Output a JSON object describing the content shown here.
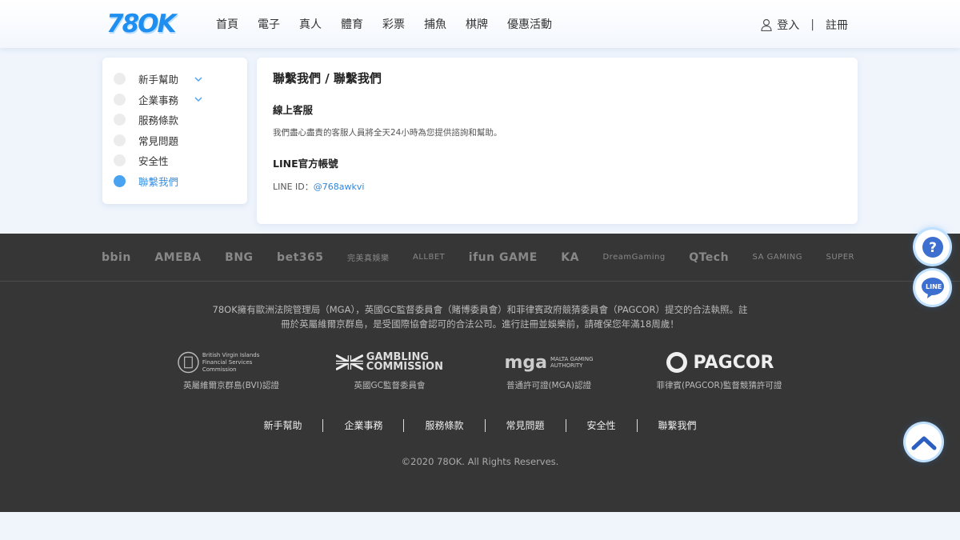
{
  "header": {
    "logo_text": "78OK",
    "nav": [
      "首頁",
      "電子",
      "真人",
      "體育",
      "彩票",
      "捕魚",
      "棋牌",
      "優惠活動"
    ],
    "login": "登入",
    "separator": "|",
    "register": "註冊"
  },
  "sidebar": {
    "items": [
      {
        "label": "新手幫助",
        "expandable": true,
        "active": false
      },
      {
        "label": "企業事務",
        "expandable": true,
        "active": false
      },
      {
        "label": "服務條款",
        "expandable": false,
        "active": false
      },
      {
        "label": "常見問題",
        "expandable": false,
        "active": false
      },
      {
        "label": "安全性",
        "expandable": false,
        "active": false
      },
      {
        "label": "聯繫我們",
        "expandable": false,
        "active": true
      }
    ]
  },
  "main": {
    "title": "聯繫我們 / 聯繫我們",
    "section1_title": "線上客服",
    "section1_text": "我們盡心盡責的客服人員將全天24小時為您提供諮詢和幫助。",
    "section2_title": "LINE官方帳號",
    "line_id_label": "LINE ID：",
    "line_id_value": "@768awkvi"
  },
  "footer": {
    "providers": [
      "bbin",
      "AMEBA",
      "BNG",
      "bet365",
      "完美真娛樂",
      "ALLBET",
      "ifun GAME",
      "KA",
      "DreamGaming",
      "QTech",
      "SA GAMING",
      "SUPER"
    ],
    "license_text": "78OK擁有歐洲法院管理局（MGA），英國GC監督委員會（賭博委員會）和菲律賓政府競猜委員會（PAGCOR）提交的合法執照。註冊於英屬維爾京群島，是受國際協會認可的合法公司。進行註冊並娛樂前，請確保您年滿18周歲！",
    "licenses": [
      {
        "logo_line1": "British Virgin Islands",
        "logo_line2": "Financial Services Commission",
        "caption": "英屬維爾京群島(BVI)認證"
      },
      {
        "logo_line1": "GAMBLING",
        "logo_line2": "COMMISSION",
        "caption": "英國GC監督委員會"
      },
      {
        "logo_main": "mga",
        "logo_line1": "MALTA GAMING",
        "logo_line2": "AUTHORITY",
        "caption": "普通許可證(MGA)認證"
      },
      {
        "logo_main": "PAGCOR",
        "caption": "菲律賓(PAGCOR)監督競猜許可證"
      }
    ],
    "links": [
      "新手幫助",
      "企業事務",
      "服務條款",
      "常見問題",
      "安全性",
      "聯繫我們"
    ],
    "copyright": "©2020 78OK. All Rights Reserves."
  },
  "floating": {
    "help_icon": "question-icon",
    "line_label": "LINE",
    "top_icon": "chevron-up-icon"
  },
  "colors": {
    "brand": "#1e8ff0",
    "active": "#4aa3f0",
    "footer_bg": "#363636",
    "page_bg": "#f0f5fc"
  }
}
